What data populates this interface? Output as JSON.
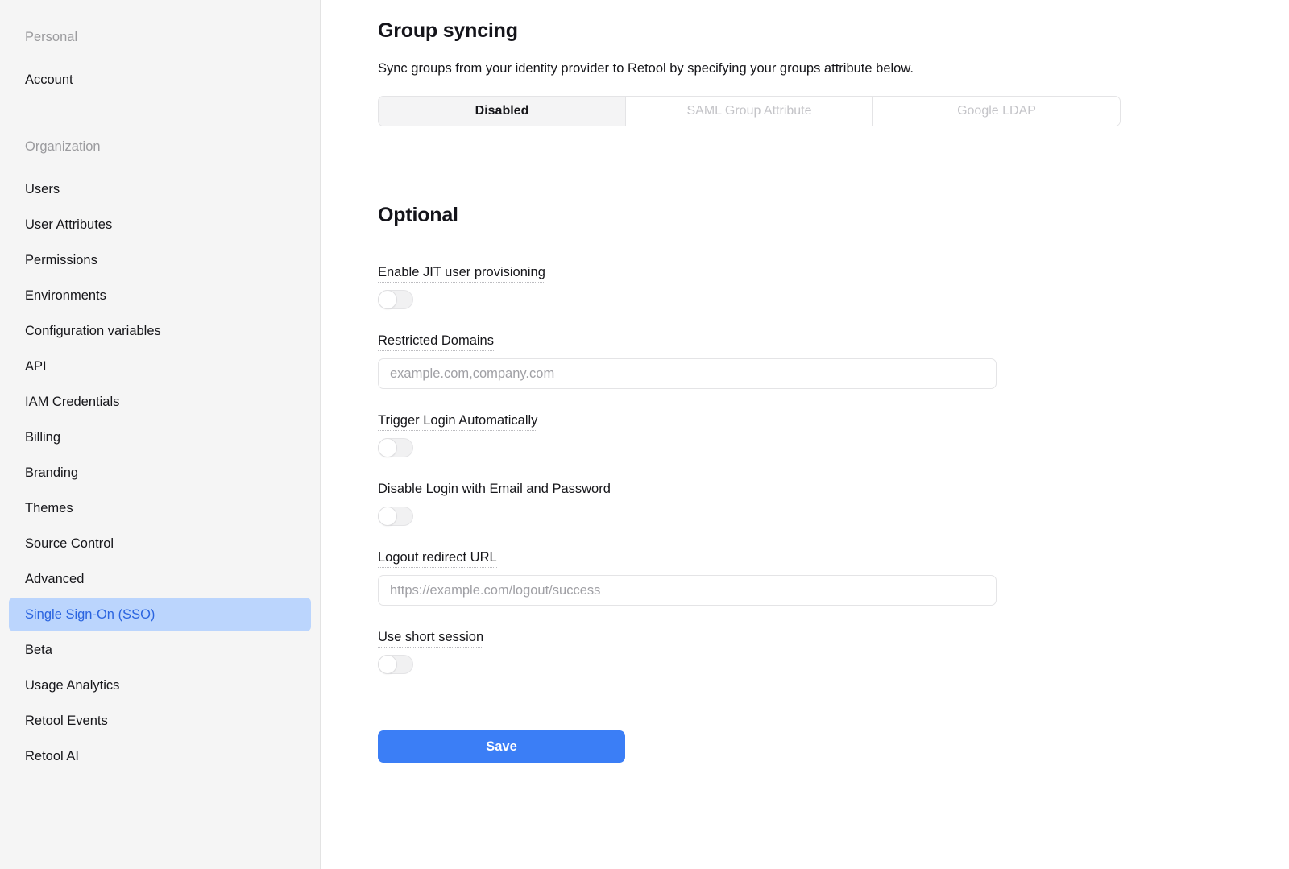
{
  "sidebar": {
    "groups": [
      {
        "label": "Personal",
        "items": [
          {
            "label": "Account",
            "active": false
          }
        ]
      },
      {
        "label": "Organization",
        "items": [
          {
            "label": "Users",
            "active": false
          },
          {
            "label": "User Attributes",
            "active": false
          },
          {
            "label": "Permissions",
            "active": false
          },
          {
            "label": "Environments",
            "active": false
          },
          {
            "label": "Configuration variables",
            "active": false
          },
          {
            "label": "API",
            "active": false
          },
          {
            "label": "IAM Credentials",
            "active": false
          },
          {
            "label": "Billing",
            "active": false
          },
          {
            "label": "Branding",
            "active": false
          },
          {
            "label": "Themes",
            "active": false
          },
          {
            "label": "Source Control",
            "active": false
          },
          {
            "label": "Advanced",
            "active": false
          },
          {
            "label": "Single Sign-On (SSO)",
            "active": true
          },
          {
            "label": "Beta",
            "active": false
          },
          {
            "label": "Usage Analytics",
            "active": false
          },
          {
            "label": "Retool Events",
            "active": false
          },
          {
            "label": "Retool AI",
            "active": false
          }
        ]
      }
    ]
  },
  "main": {
    "group_syncing": {
      "title": "Group syncing",
      "description": "Sync groups from your identity provider to Retool by specifying your groups attribute below.",
      "segments": [
        {
          "label": "Disabled",
          "active": true
        },
        {
          "label": "SAML Group Attribute",
          "active": false
        },
        {
          "label": "Google LDAP",
          "active": false
        }
      ]
    },
    "optional": {
      "title": "Optional",
      "jit": {
        "label": "Enable JIT user provisioning",
        "checked": false
      },
      "restricted_domains": {
        "label": "Restricted Domains",
        "value": "",
        "placeholder": "example.com,company.com"
      },
      "trigger_login": {
        "label": "Trigger Login Automatically",
        "checked": false
      },
      "disable_email_login": {
        "label": "Disable Login with Email and Password",
        "checked": false
      },
      "logout_redirect": {
        "label": "Logout redirect URL",
        "value": "",
        "placeholder": "https://example.com/logout/success"
      },
      "short_session": {
        "label": "Use short session",
        "checked": false
      }
    },
    "save_label": "Save"
  },
  "colors": {
    "accent": "#3b7ef6",
    "sidebar_active_bg": "#bbd5fd",
    "sidebar_active_text": "#2a64e0",
    "sidebar_bg": "#f5f5f5",
    "segment_active_bg": "#f4f4f5"
  }
}
